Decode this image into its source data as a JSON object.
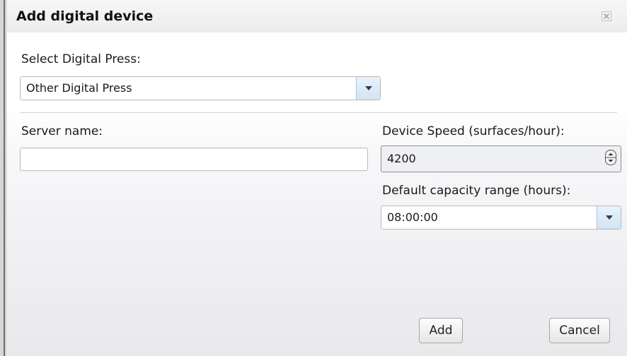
{
  "dialog": {
    "title": "Add digital device",
    "close_icon": "close-icon"
  },
  "press": {
    "label": "Select Digital Press:",
    "selected": "Other Digital Press",
    "dropdown_icon": "chevron-down-icon"
  },
  "server": {
    "label": "Server name:",
    "value": ""
  },
  "speed": {
    "label": "Device Speed (surfaces/hour):",
    "value": "4200",
    "stepper_icon": "spinner-icon"
  },
  "capacity": {
    "label": "Default capacity range (hours):",
    "selected": "08:00:00",
    "dropdown_icon": "chevron-down-icon"
  },
  "buttons": {
    "add": "Add",
    "cancel": "Cancel"
  },
  "colors": {
    "dropdown_accent": "#d3e4f4",
    "title_bar": "#ececec"
  }
}
